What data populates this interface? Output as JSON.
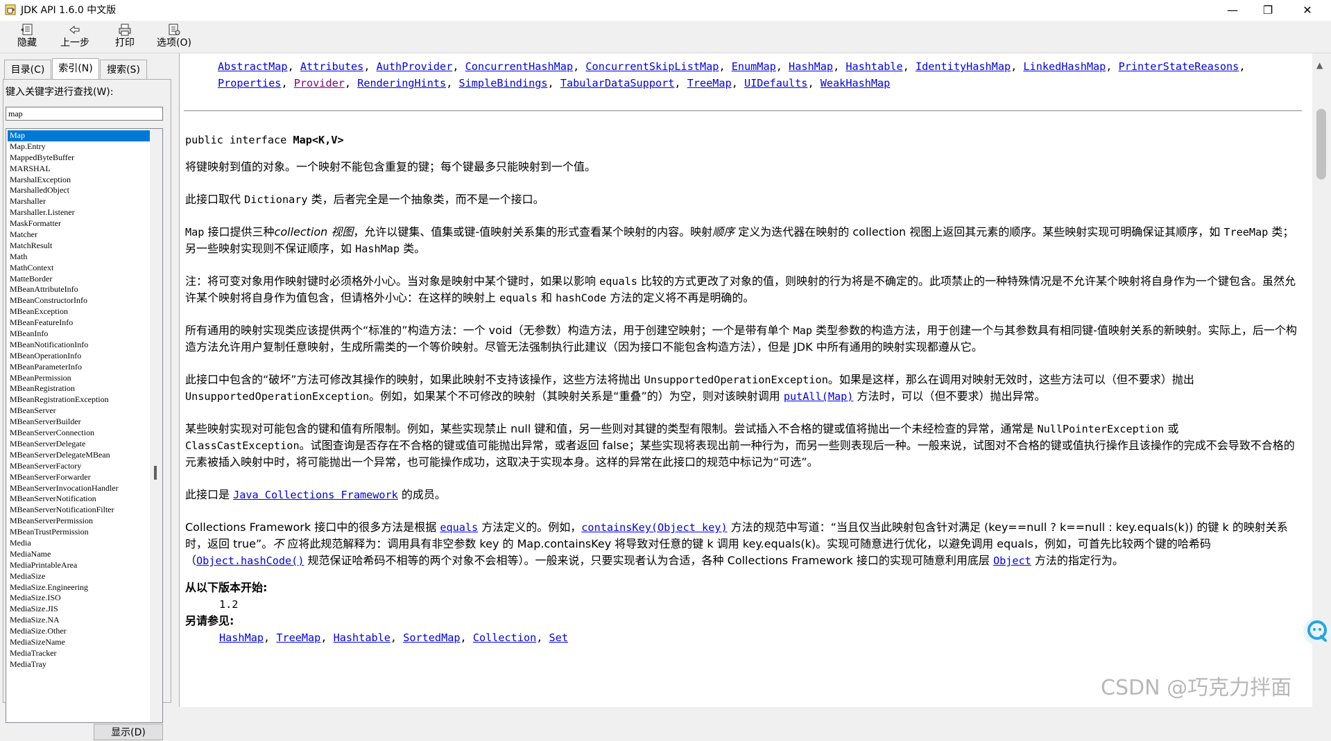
{
  "window": {
    "title": "JDK API 1.6.0 中文版",
    "minimize": "—",
    "maximize": "❐",
    "close": "✕"
  },
  "toolbar": {
    "hide_label": "隐藏",
    "back_label": "上一步",
    "print_label": "打印",
    "options_label": "选项(O)"
  },
  "tabs": {
    "contents": "目录(C)",
    "index": "索引(N)",
    "search": "搜索(S)"
  },
  "index_panel": {
    "keyword_label": "键入关键字进行查找(W):",
    "search_value": "map",
    "show_button": "显示(D)",
    "items": [
      "Map",
      "Map.Entry",
      "MappedByteBuffer",
      "MARSHAL",
      "MarshalException",
      "MarshalledObject",
      "Marshaller",
      "Marshaller.Listener",
      "MaskFormatter",
      "Matcher",
      "MatchResult",
      "Math",
      "MathContext",
      "MatteBorder",
      "MBeanAttributeInfo",
      "MBeanConstructorInfo",
      "MBeanException",
      "MBeanFeatureInfo",
      "MBeanInfo",
      "MBeanNotificationInfo",
      "MBeanOperationInfo",
      "MBeanParameterInfo",
      "MBeanPermission",
      "MBeanRegistration",
      "MBeanRegistrationException",
      "MBeanServer",
      "MBeanServerBuilder",
      "MBeanServerConnection",
      "MBeanServerDelegate",
      "MBeanServerDelegateMBean",
      "MBeanServerFactory",
      "MBeanServerForwarder",
      "MBeanServerInvocationHandler",
      "MBeanServerNotification",
      "MBeanServerNotificationFilter",
      "MBeanServerPermission",
      "MBeanTrustPermission",
      "Media",
      "MediaName",
      "MediaPrintableArea",
      "MediaSize",
      "MediaSize.Engineering",
      "MediaSize.ISO",
      "MediaSize.JIS",
      "MediaSize.NA",
      "MediaSize.Other",
      "MediaSizeName",
      "MediaTracker",
      "MediaTray"
    ]
  },
  "content": {
    "impl_classes": [
      "AbstractMap",
      "Attributes",
      "AuthProvider",
      "ConcurrentHashMap",
      "ConcurrentSkipListMap",
      "EnumMap",
      "HashMap",
      "Hashtable",
      "IdentityHashMap",
      "LinkedHashMap",
      "PrinterStateReasons",
      "Properties",
      "Provider",
      "RenderingHints",
      "SimpleBindings",
      "TabularDataSupport",
      "TreeMap",
      "UIDefaults",
      "WeakHashMap"
    ],
    "declaration_prefix": "public interface ",
    "declaration_name": "Map<K,V>",
    "p1": "将键映射到值的对象。一个映射不能包含重复的键；每个键最多只能映射到一个值。",
    "p2": {
      "a": "此接口取代 ",
      "code": "Dictionary",
      "b": " 类，后者完全是一个抽象类，而不是一个接口。"
    },
    "p3": {
      "a": "Map",
      "b": " 接口提供三种",
      "em1": "collection 视图",
      "c": "，允许以键集、值集或键-值映射关系集的形式查看某个映射的内容。映射",
      "em2": "顺序",
      "d": " 定义为迭代器在映射的 collection 视图上返回其元素的顺序。某些映射实现可明确保证其顺序，如 ",
      "code1": "TreeMap",
      "e": " 类；另一些映射实现则不保证顺序，如 ",
      "code2": "HashMap",
      "f": " 类。"
    },
    "p4": {
      "a": "注：将可变对象用作映射键时必须格外小心。当对象是映射中某个键时，如果以影响 ",
      "code1": "equals",
      "b": " 比较的方式更改了对象的值，则映射的行为将是不确定的。此项禁止的一种特殊情况是不允许某个映射将自身作为一个键包含。虽然允许某个映射将自身作为值包含，但请格外小心：在这样的映射上 ",
      "code2": "equals",
      "c": " 和 ",
      "code3": "hashCode",
      "d": " 方法的定义将不再是明确的。"
    },
    "p5": {
      "a": "所有通用的映射实现类应该提供两个“标准的”构造方法：一个 void（无参数）构造方法，用于创建空映射；一个是带有单个 ",
      "code1": "Map",
      "b": " 类型参数的构造方法，用于创建一个与其参数具有相同键-值映射关系的新映射。实际上，后一个构造方法允许用户复制任意映射，生成所需类的一个等价映射。尽管无法强制执行此建议（因为接口不能包含构造方法），但是 JDK 中所有通用的映射实现都遵从它。"
    },
    "p6": {
      "a": "此接口中包含的“破坏”方法可修改其操作的映射，如果此映射不支持该操作，这些方法将抛出 ",
      "code1": "UnsupportedOperationException",
      "b": "。如果是这样，那么在调用对映射无效时，这些方法可以（但不要求）抛出 ",
      "code2": "UnsupportedOperationException",
      "c": "。例如，如果某个不可修改的映射（其映射关系是“重叠”的）为空，则对该映射调用 ",
      "link1": "putAll(Map)",
      "d": " 方法时，可以（但不要求）抛出异常。"
    },
    "p7": {
      "a": "某些映射实现对可能包含的键和值有所限制。例如，某些实现禁止 null 键和值，另一些则对其键的类型有限制。尝试插入不合格的键或值将抛出一个未经检查的异常，通常是 ",
      "code1": "NullPointerException",
      "b": " 或 ",
      "code2": "ClassCastException",
      "c": "。试图查询是否存在不合格的键或值可能抛出异常，或者返回 false；某些实现将表现出前一种行为，而另一些则表现后一种。一般来说，试图对不合格的键或值执行操作且该操作的完成不会导致不合格的元素被插入映射中时，将可能抛出一个异常，也可能操作成功，这取决于实现本身。这样的异常在此接口的规范中标记为“可选”。"
    },
    "p8": {
      "a": "此接口是 ",
      "link1": "Java Collections Framework",
      "b": " 的成员。"
    },
    "p9": {
      "a": "Collections Framework 接口中的很多方法是根据 ",
      "link1": "equals",
      "b": " 方法定义的。例如，",
      "link2": "containsKey(Object key)",
      "c": " 方法的规范中写道：“当且仅当此映射包含针对满足 (key==null ? k==null : key.equals(k)) 的键 k 的映射关系时，返回 true”。",
      "em1": "不",
      "d": " 应将此规范解释为：调用具有非空参数 key 的 Map.containsKey 将导致对任意的键 k 调用 key.equals(k)。实现可随意进行优化，以避免调用 equals，例如，可首先比较两个键的哈希码（",
      "link3": "Object.hashCode()",
      "e": " 规范保证哈希码不相等的两个对象不会相等）。一般来说，只要实现者认为合适，各种 Collections Framework 接口的实现可随意利用底层 ",
      "link4": "Object",
      "f": " 方法的指定行为。"
    },
    "since_label": "从以下版本开始:",
    "since_value": "1.2",
    "see_also_label": "另请参见:",
    "see_also": [
      "HashMap",
      "TreeMap",
      "Hashtable",
      "SortedMap",
      "Collection",
      "Set"
    ]
  },
  "watermark": "CSDN @巧克力拌面"
}
